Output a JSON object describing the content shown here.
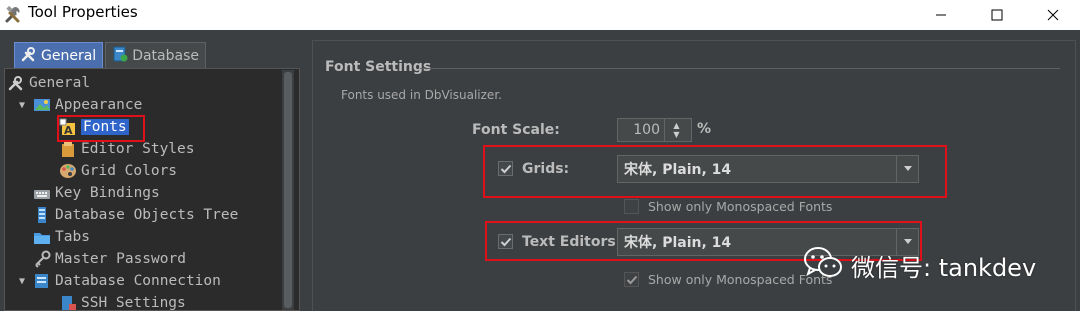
{
  "window": {
    "title": "Tool Properties",
    "icon": "tools-icon",
    "controls": [
      "minimize",
      "maximize",
      "close"
    ]
  },
  "tabs": [
    {
      "label": "General",
      "icon": "tools-icon",
      "active": true
    },
    {
      "label": "Database",
      "icon": "database-icon",
      "active": false
    }
  ],
  "tree": [
    {
      "label": "General",
      "icon": "tools-icon",
      "level": 0,
      "expand": ""
    },
    {
      "label": "Appearance",
      "icon": "appearance-icon",
      "level": 1,
      "expand": "▼"
    },
    {
      "label": "Fonts",
      "icon": "fonts-icon",
      "level": 2,
      "expand": "",
      "selected": true
    },
    {
      "label": "Editor Styles",
      "icon": "editor-styles-icon",
      "level": 2,
      "expand": ""
    },
    {
      "label": "Grid Colors",
      "icon": "palette-icon",
      "level": 2,
      "expand": ""
    },
    {
      "label": "Key Bindings",
      "icon": "keyboard-icon",
      "level": 1,
      "expand": ""
    },
    {
      "label": "Database Objects Tree",
      "icon": "tree-icon",
      "level": 1,
      "expand": ""
    },
    {
      "label": "Tabs",
      "icon": "folder-icon",
      "level": 1,
      "expand": ""
    },
    {
      "label": "Master Password",
      "icon": "key-icon",
      "level": 1,
      "expand": ""
    },
    {
      "label": "Database Connection",
      "icon": "db-connection-icon",
      "level": 1,
      "expand": "▼"
    },
    {
      "label": "SSH Settings",
      "icon": "ssh-icon",
      "level": 2,
      "expand": ""
    }
  ],
  "settings": {
    "section_title": "Font Settings",
    "hint": "Fonts used in DbVisualizer.",
    "font_scale_label": "Font Scale:",
    "font_scale_value": "100",
    "font_scale_unit": "%",
    "grids": {
      "label": "Grids:",
      "checked": true,
      "font": "宋体, Plain, 14",
      "mono_label": "Show only Monospaced Fonts",
      "mono_checked": false
    },
    "text_editors": {
      "label": "Text Editors:",
      "checked": true,
      "font": "宋体, Plain, 14",
      "mono_label": "Show only Monospaced Fonts",
      "mono_checked": true
    }
  },
  "watermark": {
    "text": "微信号: tankdev",
    "icon": "wechat-icon"
  },
  "colors": {
    "background": "#3c3f41",
    "tree_background": "#2b2b2b",
    "selection": "#2f65ca",
    "active_tab": "#4b6eaf",
    "highlight_box": "#e0101a",
    "text": "#bbbbbb"
  }
}
